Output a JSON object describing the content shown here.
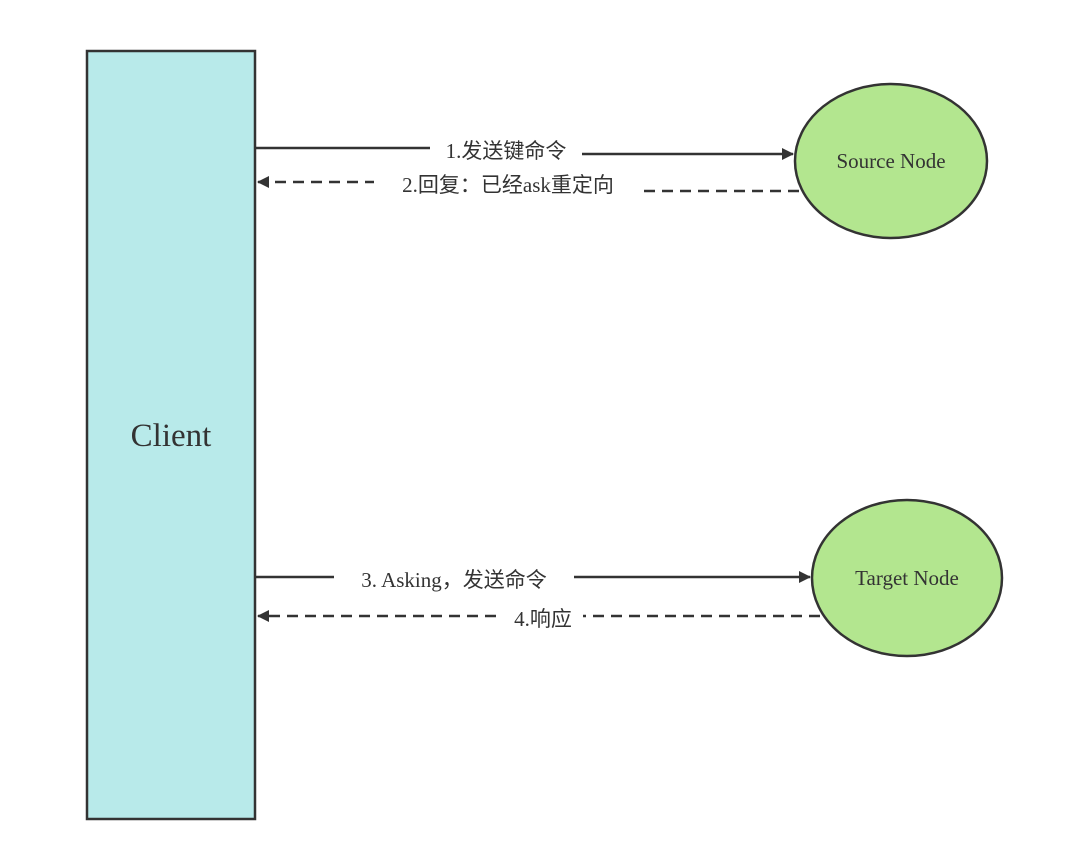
{
  "nodes": {
    "client": {
      "label": "Client",
      "fill": "#b8eaea"
    },
    "source": {
      "label": "Source Node",
      "fill": "#b3e68f"
    },
    "target": {
      "label": "Target Node",
      "fill": "#b3e68f"
    }
  },
  "edges": [
    {
      "label": "1.发送键命令",
      "from": "Client",
      "to": "Source Node",
      "style": "solid"
    },
    {
      "label": "2.回复：已经ask重定向",
      "from": "Source Node",
      "to": "Client",
      "style": "dashed"
    },
    {
      "label": "3. Asking，发送命令",
      "from": "Client",
      "to": "Target Node",
      "style": "solid"
    },
    {
      "label": "4.响应",
      "from": "Target Node",
      "to": "Client",
      "style": "dashed"
    }
  ],
  "colors": {
    "stroke": "#333333",
    "client_fill": "#b8eaea",
    "node_fill": "#b3e68f"
  }
}
